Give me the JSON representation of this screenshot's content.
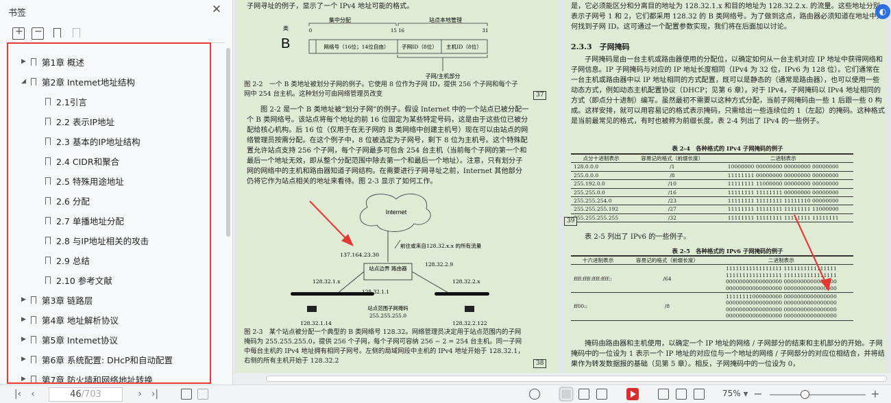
{
  "sidebar": {
    "title": "书签",
    "items": [
      {
        "label": "第1章 概述",
        "level": 0,
        "arrow": "▶"
      },
      {
        "label": "第2章 Intemet地址结构",
        "level": 0,
        "arrow": "◢"
      },
      {
        "label": "2.1引言",
        "level": 1,
        "arrow": ""
      },
      {
        "label": "2.2 表示IP地址",
        "level": 1,
        "arrow": ""
      },
      {
        "label": "2.3 基本的IP地址结构",
        "level": 1,
        "arrow": ""
      },
      {
        "label": "2.4 CIDR和聚合",
        "level": 1,
        "arrow": ""
      },
      {
        "label": "2.5 特殊用途地址",
        "level": 1,
        "arrow": ""
      },
      {
        "label": "2.6 分配",
        "level": 1,
        "arrow": ""
      },
      {
        "label": "2.7 单播地址分配",
        "level": 1,
        "arrow": ""
      },
      {
        "label": "2.8 与IP地址相关的攻击",
        "level": 1,
        "arrow": ""
      },
      {
        "label": "2.9 总结",
        "level": 1,
        "arrow": ""
      },
      {
        "label": "2.10 参考文献",
        "level": 1,
        "arrow": ""
      },
      {
        "label": "第3章 链路层",
        "level": 0,
        "arrow": "▶"
      },
      {
        "label": "第4章 地址解析协议",
        "level": 0,
        "arrow": "▶"
      },
      {
        "label": "第5章 Intemet协议",
        "level": 0,
        "arrow": "▶"
      },
      {
        "label": "第6章 系统配置: DHcP和自动配置",
        "level": 0,
        "arrow": "▶"
      },
      {
        "label": "第7章 防火墙和网络地址转换",
        "level": 0,
        "arrow": "▶"
      }
    ]
  },
  "left_page": {
    "intro": "子网寻址的例子，显示了一个 IPv4 地址可能的格式。",
    "fig22": {
      "hdr_central": "集中分配",
      "hdr_site": "站点本地管理",
      "class_label": "类",
      "class_letter": "B",
      "bit0": "0",
      "bit15": "15 16",
      "bit31": "31",
      "net": "网络号（16位；14位自由）",
      "subnet": "子网ID（8位）",
      "host": "主机ID（8位）",
      "subhost": "子网/主机部分"
    },
    "cap22": "图 2-2　一个 B 类地址被划分子网的例子。它使用 8 位作为子网 ID，提供 256 个子网和每个子网中 254 台主机。这种划分可由网络管理员改变",
    "pnum37": "37",
    "body": "图 2-2 是一个 B 类地址被“划分子网”的例子。假设 Internet 中的一个站点已被分配一个 B 类网络号。该站点将每个地址的前 16 位固定为某些特定号码，这是由于这些位已被分配给核心机构。后 16 位（仅用于在无子网的 B 类网络中创建主机号）现在可以由站点的网络管理员按需分配。在这个例子中，8 位被选定为子网号，剩下 8 位为主机号。这个特殊配置允许站点支持 256 个子网，每个子网最多可包含 254 台主机（当前每个子网的第一个和最后一个地址无效，即从整个分配范围中除去第一个和最后一个地址）。注意，只有划分子网的网络中的主机和路由器知道子网结构。在需要进行子网寻址之前，Internet 其他部分仍将它作为站点相关的地址来看待。图 2-3 显示了如何工作。",
    "fig23": {
      "internet": "Internet",
      "ext_ip": "137.164.23.30",
      "inbound": "前往或来自128.32.x.x 的所有流量",
      "router_ip": "128.32.2.9",
      "router": "站点边界 路由器",
      "lan1": "128.32.1.x",
      "lan2": "128.32.2.x",
      "gw1": "128.32.1.1",
      "mask_label": "站点范围子网掩码",
      "mask": "255.255.255.0",
      "host1": "128.32.1.14",
      "host2": "128.32.2.122"
    },
    "cap23": "图 2-3　某个站点被分配一个典型的 B 类网络号 128.32。网络管理员决定用于站点范围内的子网掩码为 255.255.255.0，提供 256 个子网，每个子网可容纳 256 − 2 = 254 台主机。同一子网中每台主机的 IPv4 地址拥有相同子网号。左侧的局域网段中主机的 IPv4 地址开始于 128.32.1，右侧的所有主机开始于 128.32.2",
    "pnum38": "38"
  },
  "right_page": {
    "top": "是，它必须能区分和分离目的地址为 128.32.1.x 和目的地址为 128.32.2.x. 的流量。这些地址分别表示子网号 1 和 2，它们都采用 128.32 的 B 类网络号。为了做到这点，路由器必须知道在地址中如何找到子网 ID。这可通过一个配置参数实现，我们将在后面加以讨论。",
    "h233": "2.3.3　子网掩码",
    "body1": "子网掩码是由一台主机或路由器使用的分配位，以确定如何从一台主机对应 IP 地址中获得网络和子网信息。IP 子网掩码与对应的 IP 地址长度相同（IPv4 为 32 位，IPv6 为 128 位）。它们通常在一台主机或路由器中以 IP 地址相同的方式配置，既可以是静态的（通常是路由器），也可以使用一些动态方式，例如动态主机配置协议（DHCP；见第 6 章）。对于 IPv4，子网掩码以 IPv4 地址相同的方式（即点分十进制）编写。虽然最初不需要以这种方式分配，当前子网掩码由一些 1 后跟一些 0 构成。这样安排，就可以用容易记的格式表示掩码，只需给出一些连续位的 1（左起）的掩码。这种格式是当前最常见的格式，有时也被称为前缀长度。表 2-4 列出了 IPv4 的一些例子。",
    "t24_title": "表 2-4　各种格式的 IPv4 子网掩码的例子",
    "t24_headers": [
      "点分十进制表示",
      "容易记的格式（前缀长度）",
      "二进制表示"
    ],
    "t24_rows": [
      [
        "128.0.0.0",
        "/1",
        "10000000 00000000 00000000 00000000"
      ],
      [
        "255.0.0.0",
        "/8",
        "11111111 00000000 00000000 00000000"
      ],
      [
        "255.192.0.0",
        "/10",
        "11111111 11000000 00000000 00000000"
      ],
      [
        "255.255.0.0",
        "/16",
        "11111111 11111111 00000000 00000000"
      ],
      [
        "255.255.254.0",
        "/23",
        "11111111 11111111 11111110 00000000"
      ],
      [
        "255.255.255.192",
        "/27",
        "11111111 11111111 11111111 11000000"
      ],
      [
        "255.255.255.255",
        "/32",
        "11111111 11111111 11111111 11111111"
      ]
    ],
    "pnum39": "39",
    "intro25": "表 2-5 列出了 IPv6 的一些例子。",
    "t25_title": "表 2-5　各种格式的 IPv6 子网掩码的例子",
    "t25_headers": [
      "十六进制表示",
      "容易记的格式（前缀长度）",
      "二进制表示"
    ],
    "t25_rows": [
      [
        "ffff:ffff:ffff:ffff::",
        "/64",
        "11111111111111111 1111111111111111\n11111111111111111 1111111111111111\n00000000000000000 0000000000000000\n00000000000000000 0000000000000000"
      ],
      [
        "ff00::",
        "/8",
        "11111111000000000 0000000000000000\n00000000000000000 0000000000000000\n00000000000000000 0000000000000000\n00000000000000000 0000000000000000"
      ]
    ],
    "body2": "掩码由路由器和主机使用，以确定一个 IP 地址的网络 / 子网部分的结束和主机部分的开始。子网掩码中的一位设为 1 表示一个 IP 地址的对应位与一个地址的网络 / 子网部分的对应位相结合，并将结果作为转发数据报的基础（见第 5 章）。相反，子网掩码中的一位设为 0，"
  },
  "status": {
    "page_current": "46",
    "page_total": "/703",
    "zoom": "75%"
  },
  "colors": {
    "accent": "#e53935",
    "page_bg": "#e0ebd5",
    "play": "#d9302f"
  }
}
